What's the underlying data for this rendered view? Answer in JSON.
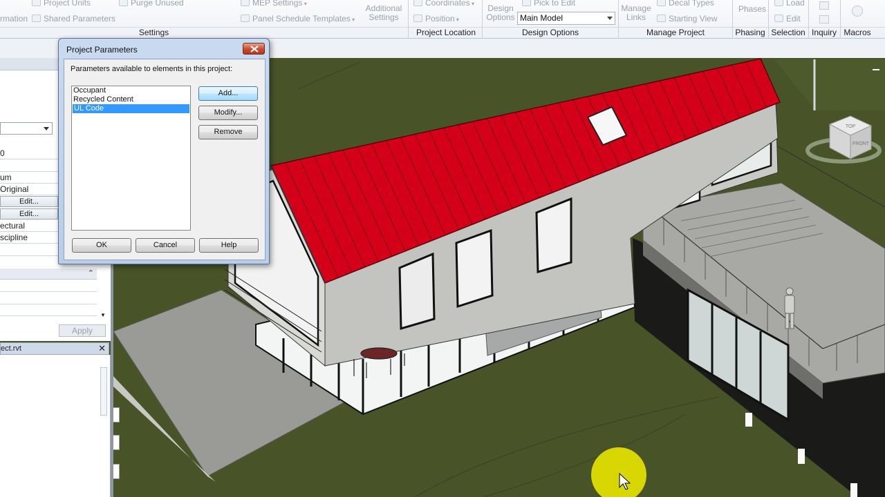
{
  "ribbon": {
    "settings_items": [
      {
        "label": "Project Units",
        "icon": "units-icon"
      },
      {
        "label": "Shared Parameters",
        "icon": "shared-parameters-icon"
      },
      {
        "label": "Purge Unused",
        "icon": "purge-icon"
      },
      {
        "label": "MEP Settings",
        "icon": "mep-settings-icon"
      },
      {
        "label": "Panel Schedule Templates",
        "icon": "panel-schedule-icon"
      },
      {
        "label": "Additional Settings",
        "icon": "additional-settings-icon"
      }
    ],
    "left_fragment": "rmation",
    "location_items": [
      {
        "label": "Coordinates",
        "icon": "coordinates-icon"
      },
      {
        "label": "Position",
        "icon": "position-icon"
      }
    ],
    "design_options": {
      "label": "Design Options",
      "pick_to_edit": "Pick to Edit",
      "selected": "Main Model"
    },
    "manage_links_label": "Manage Links",
    "decal_types_label": "Decal Types",
    "starting_view_label": "Starting View",
    "phases_label": "Phases",
    "load_label": "Load",
    "edit_label": "Edit",
    "panels": [
      "Settings",
      "Project Location",
      "Design Options",
      "Manage Project",
      "Phasing",
      "Selection",
      "Inquiry",
      "Macros"
    ]
  },
  "properties": {
    "values": [
      "0",
      "um",
      "Original",
      "ectural",
      "scipline"
    ],
    "edit_label": "Edit...",
    "apply_label": "Apply"
  },
  "browser": {
    "title": "ect.rvt"
  },
  "dialog": {
    "title": "Project Parameters",
    "prompt": "Parameters available to elements in this project:",
    "parameters": [
      "Occupant",
      "Recycled Content",
      "UL Code"
    ],
    "selected_parameter": "UL Code",
    "add_label": "Add...",
    "modify_label": "Modify...",
    "remove_label": "Remove",
    "ok_label": "OK",
    "cancel_label": "Cancel",
    "help_label": "Help"
  },
  "viewcube": {
    "top_label": "TOP",
    "front_label": "FRONT"
  },
  "colors": {
    "roof": "#d4001a",
    "ground": "#485427",
    "selection": "#3399ff"
  }
}
